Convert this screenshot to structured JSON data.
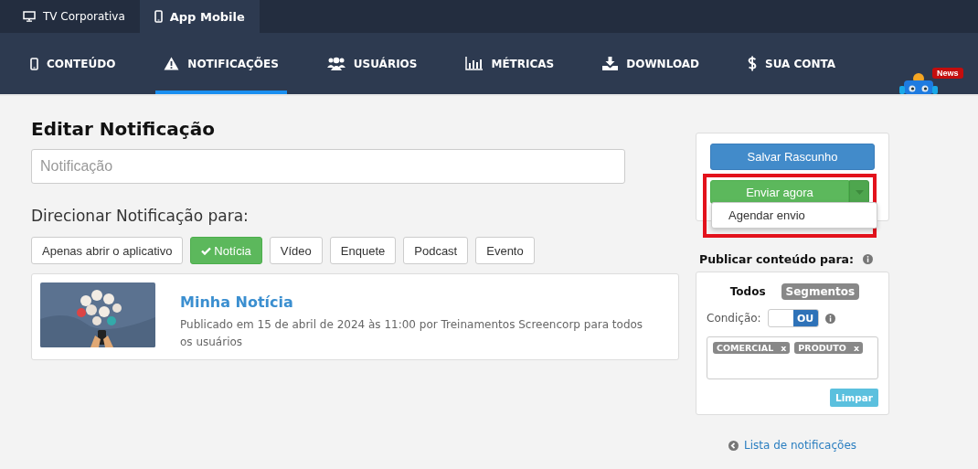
{
  "top_tabs": [
    {
      "label": "TV Corporativa",
      "selected": false
    },
    {
      "label": "App Mobile",
      "selected": true
    }
  ],
  "nav": [
    {
      "label": "CONTEÚDO",
      "selected": false
    },
    {
      "label": "NOTIFICAÇÕES",
      "selected": true
    },
    {
      "label": "USUÁRIOS",
      "selected": false
    },
    {
      "label": "MÉTRICAS",
      "selected": false
    },
    {
      "label": "DOWNLOAD",
      "selected": false
    },
    {
      "label": "SUA CONTA",
      "selected": false
    }
  ],
  "news_badge": "News",
  "page_title": "Editar Notificação",
  "title_field": {
    "placeholder": "Notificação"
  },
  "target_heading": "Direcionar Notificação para:",
  "target_options": [
    {
      "label": "Apenas abrir o aplicativo",
      "selected": false
    },
    {
      "label": "Notícia",
      "selected": true
    },
    {
      "label": "Vídeo",
      "selected": false
    },
    {
      "label": "Enquete",
      "selected": false
    },
    {
      "label": "Podcast",
      "selected": false
    },
    {
      "label": "Evento",
      "selected": false
    }
  ],
  "content_card": {
    "kind": "picture",
    "title": "Minha Notícia",
    "description": "Publicado em 15 de abril de 2024 às 11:00 por Treinamentos Screencorp para todos os usuários"
  },
  "save_button": "Salvar Rascunho",
  "send_button": "Enviar agora",
  "send_menu": [
    {
      "label": "Agendar envio"
    }
  ],
  "send_highlighted": true,
  "publish_heading": "Publicar conteúdo para:",
  "audience_tabs": [
    {
      "label": "Todos",
      "selected": false
    },
    {
      "label": "Segmentos",
      "selected": true
    }
  ],
  "condition_label": "Condição:",
  "condition_toggle": {
    "label": "OU",
    "on": true
  },
  "segments": [
    {
      "label": "COMERCIAL",
      "remove": "x"
    },
    {
      "label": "PRODUTO",
      "remove": "x"
    }
  ],
  "clear_button": "Limpar",
  "back_link": "Lista de notificações"
}
